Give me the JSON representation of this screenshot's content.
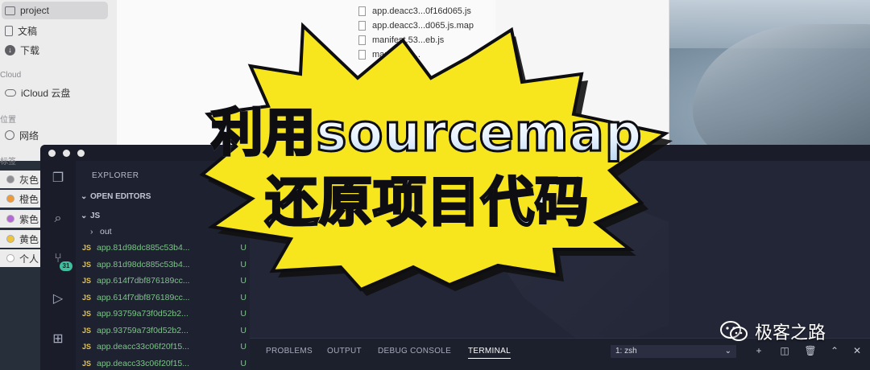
{
  "finder": {
    "sidebar": {
      "items": [
        {
          "label": "project",
          "icon": "folder-icon",
          "selected": true
        },
        {
          "label": "文稿",
          "icon": "document-icon"
        },
        {
          "label": "下载",
          "icon": "download-icon"
        }
      ],
      "cloud_heading": "Cloud",
      "cloud_items": [
        {
          "label": "iCloud 云盘",
          "icon": "cloud-icon"
        }
      ],
      "location_heading": "位置",
      "location_items": [
        {
          "label": "网络",
          "icon": "globe-icon"
        }
      ],
      "tags_heading": "标签",
      "tags": [
        {
          "label": "灰色",
          "color": "#8e8e93"
        },
        {
          "label": "橙色",
          "color": "#f09a37"
        },
        {
          "label": "紫色",
          "color": "#b569d6"
        },
        {
          "label": "黄色",
          "color": "#f0c43a"
        },
        {
          "label": "个人",
          "color": "#ffffff"
        }
      ]
    },
    "files": [
      "app.deacc3...0f16d065.js",
      "app.deacc3...d065.js.map",
      "manifest.53...eb.js",
      "manifest.5..."
    ]
  },
  "vscode": {
    "explorer": {
      "title": "EXPLORER",
      "open_editors": "OPEN EDITORS",
      "folder": "JS",
      "subfolder": "out",
      "files": [
        {
          "name": "app.81d98dc885c53b4...",
          "status": "U"
        },
        {
          "name": "app.81d98dc885c53b4...",
          "status": "U"
        },
        {
          "name": "app.614f7dbf876189cc...",
          "status": "U"
        },
        {
          "name": "app.614f7dbf876189cc...",
          "status": "U"
        },
        {
          "name": "app.93759a73f0d52b2...",
          "status": "U"
        },
        {
          "name": "app.93759a73f0d52b2...",
          "status": "U"
        },
        {
          "name": "app.deacc33c06f20f15...",
          "status": "U"
        },
        {
          "name": "app.deacc33c06f20f15...",
          "status": "U"
        }
      ],
      "file_tag": "JS"
    },
    "activity_badge": "31",
    "panel": {
      "tabs": [
        "PROBLEMS",
        "OUTPUT",
        "DEBUG CONSOLE",
        "TERMINAL"
      ],
      "active_tab": "TERMINAL",
      "terminal_select": "1: zsh"
    }
  },
  "overlay": {
    "line1": "利用sourcemap",
    "line2": "还原项目代码",
    "burst_color": "#f7e51e"
  },
  "watermark": {
    "text": "极客之路"
  }
}
